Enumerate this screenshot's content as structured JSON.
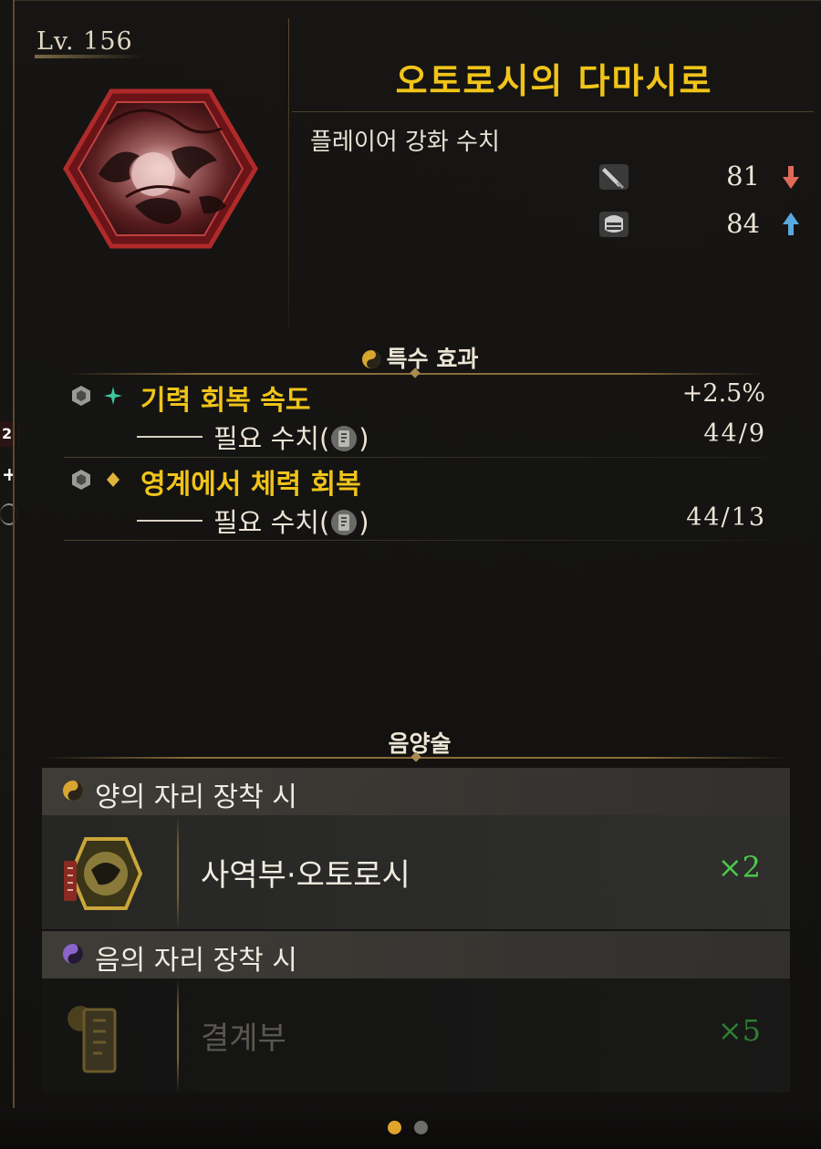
{
  "header": {
    "level": "Lv. 156",
    "title": "오토로시의 다마시로"
  },
  "stats": {
    "caption": "플레이어 강화 수치",
    "rows": [
      {
        "icon": "sword-icon",
        "value": "81",
        "trend": "down",
        "trend_color": "#e06a5a"
      },
      {
        "icon": "armor-icon",
        "value": "84",
        "trend": "up",
        "trend_color": "#5aa8e0"
      }
    ]
  },
  "special": {
    "heading": "특수 효과",
    "effects": [
      {
        "name": "기력 회복 속도",
        "value": "+2.5%",
        "requirement_label": "필요 수치(",
        "requirement_close": ")",
        "requirement_value": "44/9",
        "mark": "sparkle-icon"
      },
      {
        "name": "영계에서 체력 회복",
        "value": "",
        "requirement_label": "필요 수치(",
        "requirement_close": ")",
        "requirement_value": "44/13",
        "mark": "diamond-icon"
      }
    ]
  },
  "onmyo": {
    "heading": "음양술",
    "yang": {
      "label": "양의 자리 장착 시",
      "item_name": "사역부·오토로시",
      "item_count": "×2"
    },
    "yin": {
      "label": "음의 자리 장착 시",
      "item_name": "결계부",
      "item_count": "×5"
    }
  },
  "pagination": {
    "current": 1,
    "total": 2
  },
  "edge": {
    "badge": "2"
  },
  "colors": {
    "title_gold": "#f0c419",
    "count_green": "#4cc94a",
    "frame_gold": "#8a6d3b"
  }
}
